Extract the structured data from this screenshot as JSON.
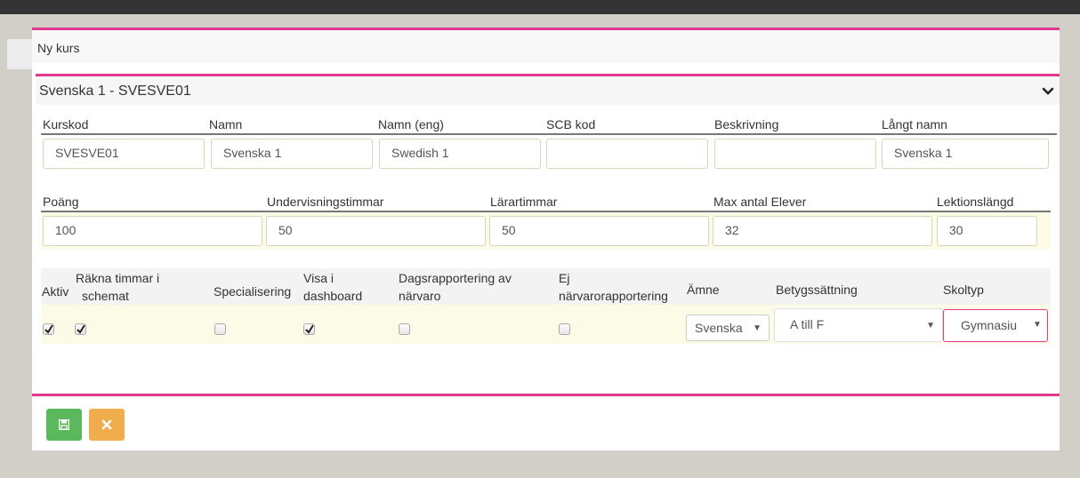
{
  "modal": {
    "title": "Ny kurs"
  },
  "panel": {
    "title": "Svenska 1 - SVESVE01"
  },
  "row1": {
    "labels": [
      "Kurskod",
      "Namn",
      "Namn (eng)",
      "SCB kod",
      "Beskrivning",
      "Långt namn"
    ],
    "values": [
      "SVESVE01",
      "Svenska 1",
      "Swedish 1",
      "",
      "",
      "Svenska 1"
    ]
  },
  "row2": {
    "labels": [
      "Poäng",
      "Undervisningstimmar",
      "Lärartimmar",
      "Max antal Elever",
      "Lektionslängd"
    ],
    "values": [
      "100",
      "50",
      "50",
      "32",
      "30"
    ]
  },
  "row3": {
    "headers": {
      "aktiv": "Aktiv",
      "rakna_line1": "Räkna timmar i",
      "rakna_line2": "schemat",
      "specialisering": "Specialisering",
      "visa_line1": "Visa i",
      "visa_line2": "dashboard",
      "dags_line1": "Dagsrapportering av",
      "dags_line2": "närvaro",
      "ej_line1": "Ej",
      "ej_line2": "närvarorapportering",
      "amne": "Ämne",
      "betyg": "Betygssättning",
      "skoltyp": "Skoltyp"
    },
    "checkboxes": {
      "aktiv": true,
      "rakna_timmar": true,
      "specialisering": false,
      "visa_dashboard": true,
      "dagsrapportering": false,
      "ej_narvaro": false
    },
    "selects": {
      "amne": "Svenska",
      "betyg": "A till F",
      "skoltyp": "Gymnasiu"
    }
  },
  "colors": {
    "accent": "#e0398e",
    "save": "#5cb85c",
    "cancel": "#f0ad4e"
  },
  "icons": {
    "save": "floppy-disk-icon",
    "cancel": "close-icon",
    "collapse": "chevron-down-icon"
  }
}
